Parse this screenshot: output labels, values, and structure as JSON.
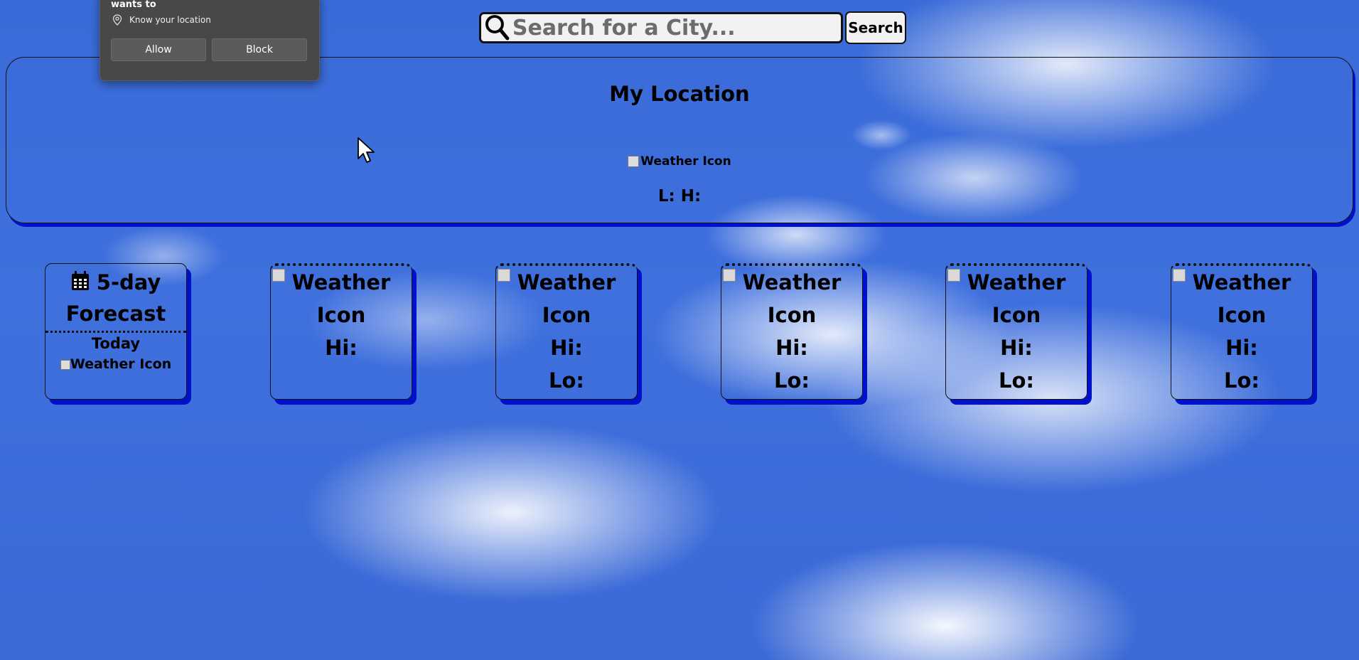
{
  "search": {
    "placeholder": "Search for a City...",
    "button_label": "Search"
  },
  "current": {
    "title": "My Location",
    "icon_alt": "Weather Icon",
    "temps": "L: H:"
  },
  "forecast": {
    "header": {
      "title_line1": "5-day",
      "title_line2": "Forecast",
      "today": "Today",
      "icon_alt": "Weather Icon"
    },
    "days": [
      {
        "icon_alt_1": "Weather",
        "icon_alt_2": "Icon",
        "hi": "Hi:",
        "lo": ""
      },
      {
        "icon_alt_1": "Weather",
        "icon_alt_2": "Icon",
        "hi": "Hi:",
        "lo": "Lo:"
      },
      {
        "icon_alt_1": "Weather",
        "icon_alt_2": "Icon",
        "hi": "Hi:",
        "lo": "Lo:"
      },
      {
        "icon_alt_1": "Weather",
        "icon_alt_2": "Icon",
        "hi": "Hi:",
        "lo": "Lo:"
      },
      {
        "icon_alt_1": "Weather",
        "icon_alt_2": "Icon",
        "hi": "Hi:",
        "lo": "Lo:"
      }
    ]
  },
  "permission_popup": {
    "heading": "wants to",
    "permission": "Know your location",
    "allow_label": "Allow",
    "block_label": "Block"
  },
  "colors": {
    "sky": "#3f70dd",
    "shadow": "#0011cc"
  }
}
